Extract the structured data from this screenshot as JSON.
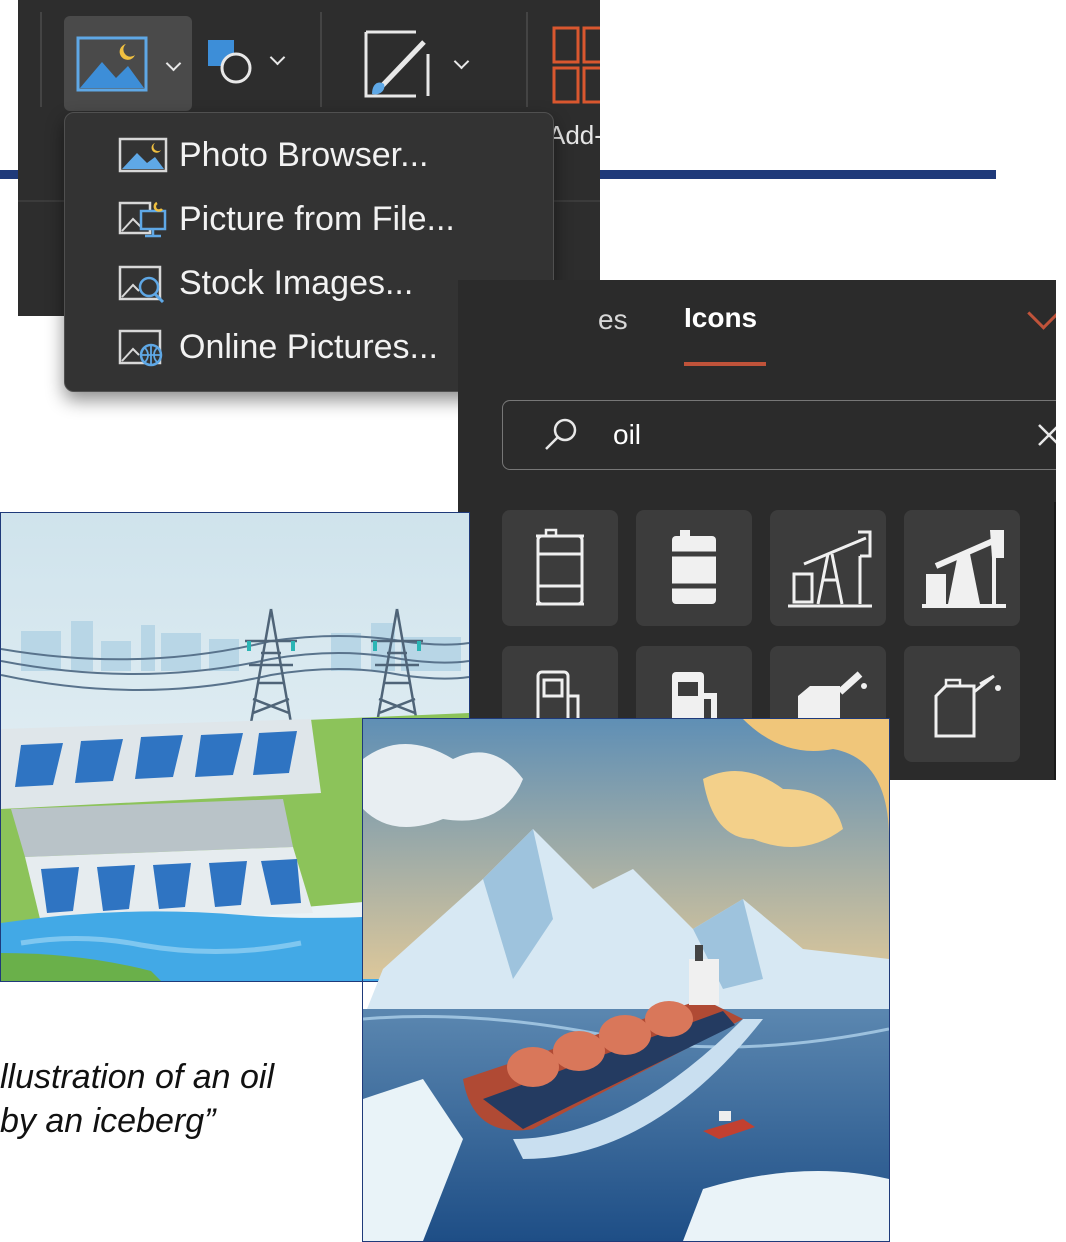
{
  "ribbon": {
    "addins_label": "Add-",
    "buttons": [
      {
        "name": "pictures",
        "icon": "picture-icon",
        "active": true
      },
      {
        "name": "shapes",
        "icon": "shapes-icon",
        "active": false
      },
      {
        "name": "draw",
        "icon": "draw-brush-icon",
        "active": false
      },
      {
        "name": "addins",
        "icon": "addins-grid-icon",
        "active": false
      }
    ]
  },
  "insert_menu": {
    "items": [
      {
        "label": "Photo Browser...",
        "icon": "photo-browser-icon"
      },
      {
        "label": "Picture from File...",
        "icon": "picture-from-file-icon"
      },
      {
        "label": "Stock Images...",
        "icon": "stock-images-icon"
      },
      {
        "label": "Online Pictures...",
        "icon": "online-pictures-icon"
      }
    ]
  },
  "icons_panel": {
    "tabs": [
      {
        "label": "es",
        "selected": false
      },
      {
        "label": "Icons",
        "selected": true
      }
    ],
    "search": {
      "value": "oil"
    },
    "results": [
      "oil-barrel-outline-icon",
      "oil-barrel-filled-icon",
      "oil-pump-outline-icon",
      "oil-pump-filled-icon",
      "fuel-pump-outline-icon",
      "fuel-pump-filled-icon",
      "oil-can-filled-icon",
      "oil-can-outline-icon"
    ]
  },
  "caption": {
    "line1": "llustration of an oil",
    "line2": "by an iceberg”"
  },
  "colors": {
    "accent": "#c0533a",
    "rule_blue": "#1f3a7a",
    "ribbon_bg": "#2d2d2d",
    "menu_bg": "#333333",
    "panel_bg": "#2b2b2b"
  }
}
